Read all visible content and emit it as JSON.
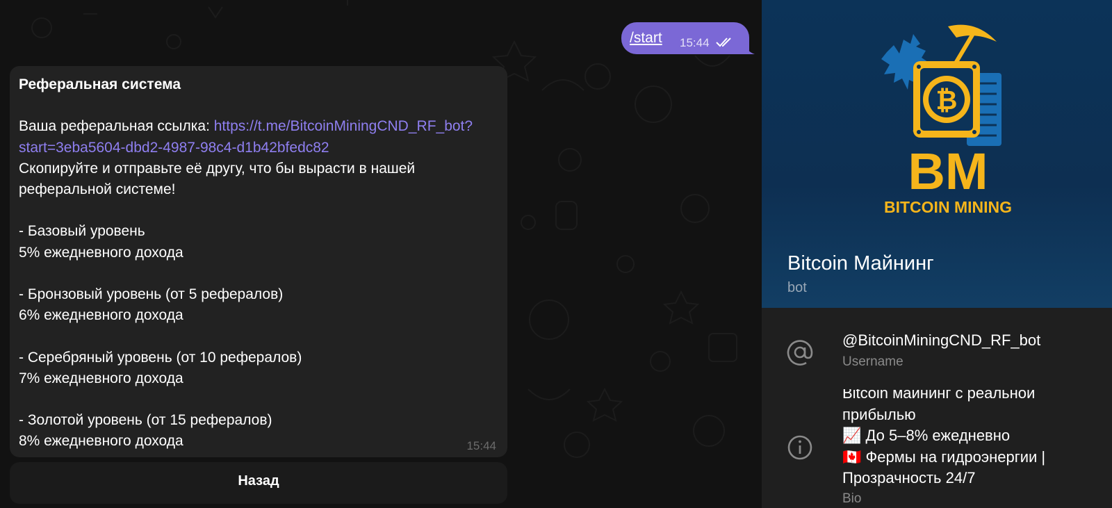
{
  "chat": {
    "outgoing": {
      "text": "/start",
      "time": "15:44"
    },
    "incoming": {
      "title": "Реферальная система",
      "link_intro": "Ваша реферальная ссылка: ",
      "link": "https://t.me/BitcoinMiningCND_RF_bot?start=3eba5604-dbd2-4987-98c4-d1b42bfedc82",
      "body": "Скопируйте и отправьте её другу, что бы вырасти в нашей реферальной системе!\n\n- Базовый уровень\n5% ежедневного дохода\n\n- Бронзовый уровень (от 5 рефералов)\n6% ежедневного дохода\n\n- Серебряный уровень (от 10 рефералов)\n7% ежедневного дохода\n\n- Золотой уровень (от 15 рефералов)\n8% ежедневного дохода",
      "time": "15:44"
    },
    "back_button": "Назад"
  },
  "profile": {
    "logo_text_big": "BM",
    "logo_text_small": "BITCOIN MINING",
    "name": "Bitcoin Майнинг",
    "subtitle": "bot",
    "username": "@BitcoinMiningCND_RF_bot",
    "username_label": "Username",
    "bio": "Bitcoin майнинг с реальной прибылью\n📈 До 5–8% ежедневно\n🇨🇦 Фермы на гидроэнергии | Прозрачность 24/7",
    "bio_label": "Bio"
  },
  "colors": {
    "accent": "#7b68d6",
    "link": "#8f7ff0",
    "logo_gold": "#f5b51b",
    "logo_blue": "#1a6fb5"
  },
  "icons": [
    "at-icon",
    "info-icon",
    "double-check-icon"
  ]
}
